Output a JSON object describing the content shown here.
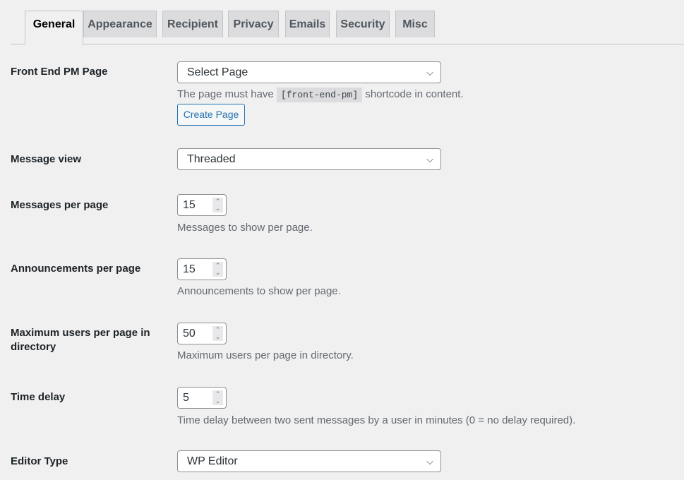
{
  "tabs": [
    {
      "label": "General",
      "active": true
    },
    {
      "label": "Appearance"
    },
    {
      "label": "Recipient"
    },
    {
      "label": "Privacy"
    },
    {
      "label": "Emails"
    },
    {
      "label": "Security"
    },
    {
      "label": "Misc"
    }
  ],
  "fields": {
    "front_end_pm_page": {
      "label": "Front End PM Page",
      "value": "Select Page",
      "desc_before": "The page must have",
      "shortcode": "[front-end-pm]",
      "desc_after": "shortcode in content.",
      "button": "Create Page"
    },
    "message_view": {
      "label": "Message view",
      "value": "Threaded"
    },
    "messages_per_page": {
      "label": "Messages per page",
      "value": "15",
      "desc": "Messages to show per page."
    },
    "announcements_per_page": {
      "label": "Announcements per page",
      "value": "15",
      "desc": "Announcements to show per page."
    },
    "max_users": {
      "label": "Maximum users per page in directory",
      "value": "50",
      "desc": "Maximum users per page in directory."
    },
    "time_delay": {
      "label": "Time delay",
      "value": "5",
      "desc": "Time delay between two sent messages by a user in minutes (0 = no delay required)."
    },
    "editor_type": {
      "label": "Editor Type",
      "value": "WP Editor"
    }
  },
  "icons": {
    "chevron": "⌵",
    "spin_up": "⌃",
    "spin_down": "⌄"
  }
}
